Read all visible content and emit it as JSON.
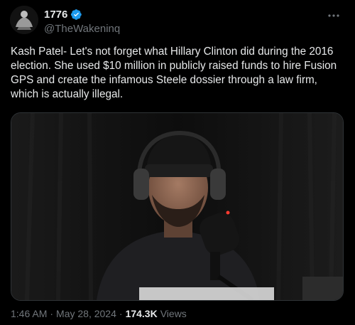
{
  "author": {
    "display_name": "1776",
    "handle": "@TheWakeninq",
    "verified": true,
    "verified_color": "#1d9bf0"
  },
  "tweet": {
    "text": "Kash Patel- Let's not forget what Hillary Clinton did during the 2016 election. She used $10 million in publicly raised funds to hire Fusion GPS and create the infamous Steele dossier through a law firm, which is actually illegal."
  },
  "media": {
    "type": "video-thumbnail",
    "description_icon": "video-frame"
  },
  "meta": {
    "time": "1:46 AM",
    "separator1": "·",
    "date": "May 28, 2024",
    "separator2": "·",
    "views_count": "174.3K",
    "views_label": "Views"
  },
  "icons": {
    "more": "more-horizontal-icon",
    "verified": "verified-badge-icon"
  },
  "colors": {
    "background": "#000000",
    "text_primary": "#e7e9ea",
    "text_secondary": "#71767b",
    "border": "#2f3336"
  }
}
